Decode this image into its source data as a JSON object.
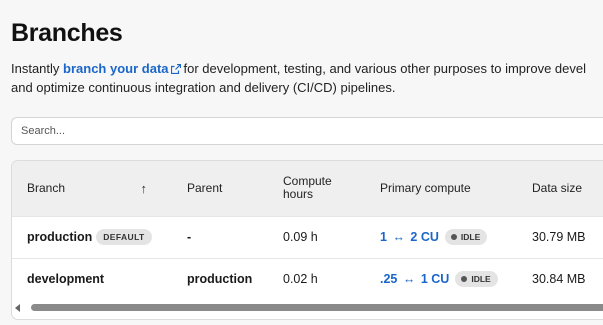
{
  "header": {
    "title": "Branches",
    "intro_prefix": "Instantly ",
    "intro_link": "branch your data",
    "intro_line1_rest": "for development, testing, and various other purposes to improve devel",
    "intro_line2": "and optimize continuous integration and delivery (CI/CD) pipelines."
  },
  "search": {
    "placeholder": "Search..."
  },
  "table": {
    "columns": {
      "branch": "Branch",
      "parent": "Parent",
      "compute_line1": "Compute",
      "compute_line2": "hours",
      "primary": "Primary compute",
      "size": "Data size"
    },
    "sort_icon": "↑",
    "rows": [
      {
        "branch": "production",
        "badge": "DEFAULT",
        "parent": "-",
        "hours": "0.09 h",
        "cu_min": "1",
        "cu_max": "2 CU",
        "state": "IDLE",
        "size": "30.79 MB"
      },
      {
        "branch": "development",
        "badge": "",
        "parent": "production",
        "hours": "0.02 h",
        "cu_min": ".25",
        "cu_max": "1 CU",
        "state": "IDLE",
        "size": "30.84 MB"
      }
    ],
    "arrow": "↔"
  },
  "icons": {
    "external_link": "external-link-icon",
    "sort": "arrow-up-icon",
    "status_dot": "dot-icon",
    "scroll_left": "caret-left-icon"
  },
  "colors": {
    "link": "#1a66c9",
    "badge_bg": "#e4e4e4",
    "header_bg": "#efefef"
  }
}
